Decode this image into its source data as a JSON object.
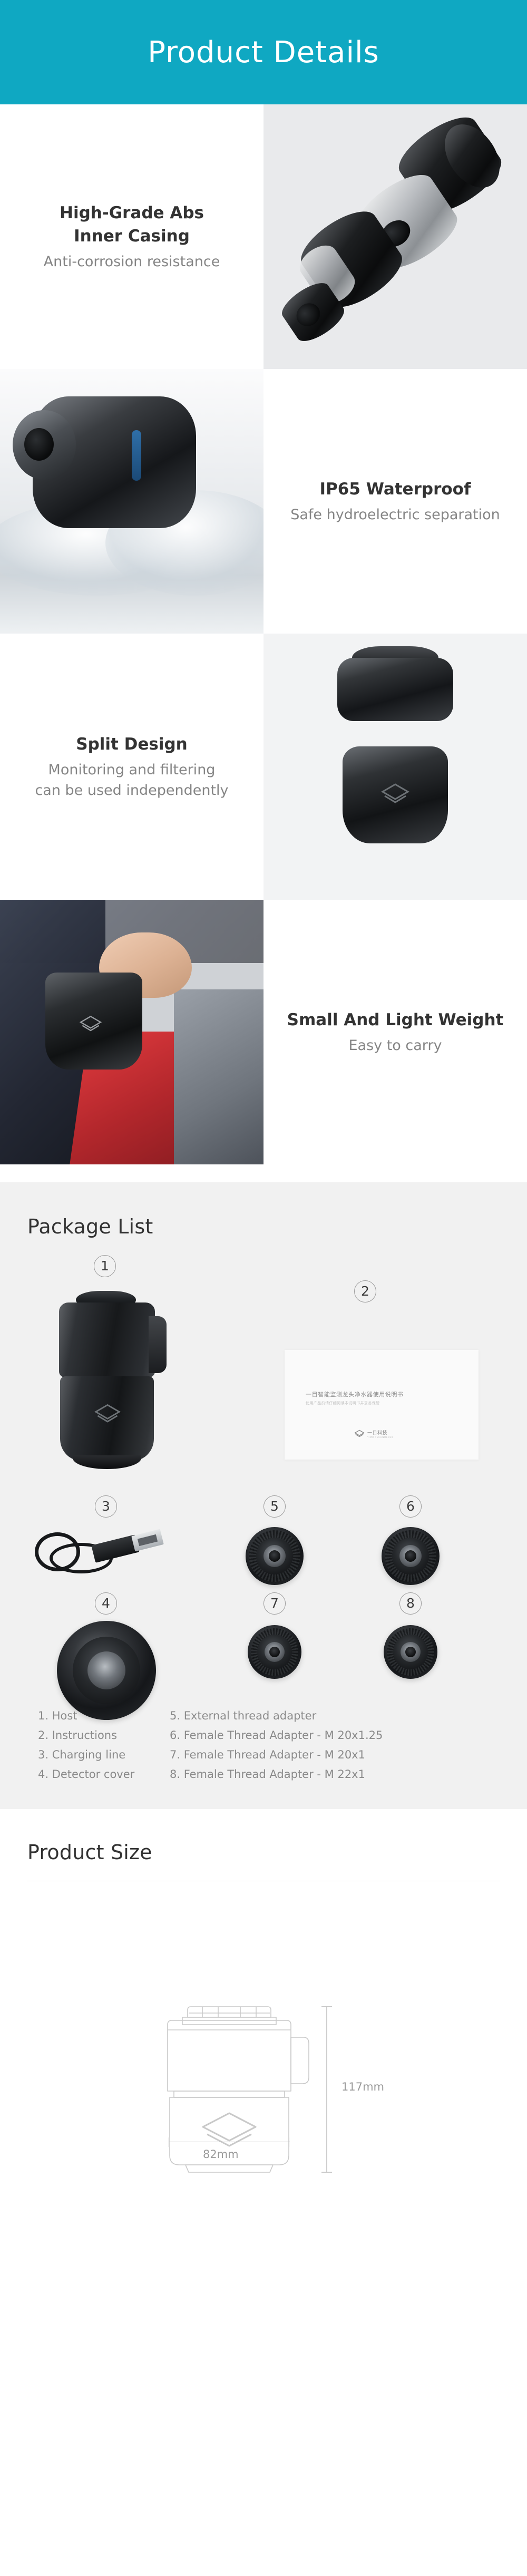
{
  "header": {
    "title": "Product Details",
    "bg_color": "#0fa8c2",
    "text_color": "#ffffff"
  },
  "features": [
    {
      "title_line1": "High-Grade Abs",
      "title_line2": "Inner Casing",
      "subtitle": "Anti-corrosion resistance",
      "image_alt": "exploded-filter-parts",
      "text_side": "left"
    },
    {
      "title_line1": "IP65 Waterproof",
      "title_line2": "",
      "subtitle": "Safe hydroelectric separation",
      "image_alt": "device-water-splash",
      "text_side": "right"
    },
    {
      "title_line1": "Split Design",
      "title_line2": "",
      "subtitle_line1": "Monitoring and filtering",
      "subtitle_line2": "can be used independently",
      "image_alt": "split-device-two-parts",
      "text_side": "left"
    },
    {
      "title_line1": "Small And Light Weight",
      "title_line2": "",
      "subtitle": "Easy to carry",
      "image_alt": "hand-holding-device-jacket",
      "text_side": "right"
    }
  ],
  "package": {
    "title": "Package List",
    "background": "#f1f1f1",
    "badges": [
      "1",
      "2",
      "3",
      "4",
      "5",
      "6",
      "7",
      "8"
    ],
    "manual": {
      "title_cn": "一目智能监测龙头净水器使用说明书",
      "subtitle_cn": "使用产品前请仔细阅读本说明书并妥善保管",
      "brand_cn": "一目科技",
      "brand_en": "YIMU TECHNOLOGY"
    },
    "items_col1": [
      "1. Host",
      "2. Instructions",
      "3. Charging line",
      "4. Detector cover"
    ],
    "items_col2": [
      "5. External thread adapter",
      "6. Female Thread Adapter - M 20x1.25",
      "7. Female Thread Adapter - M 20x1",
      "8. Female Thread Adapter - M 22x1"
    ]
  },
  "size": {
    "title": "Product Size",
    "height_label": "117mm",
    "width_label": "82mm"
  }
}
